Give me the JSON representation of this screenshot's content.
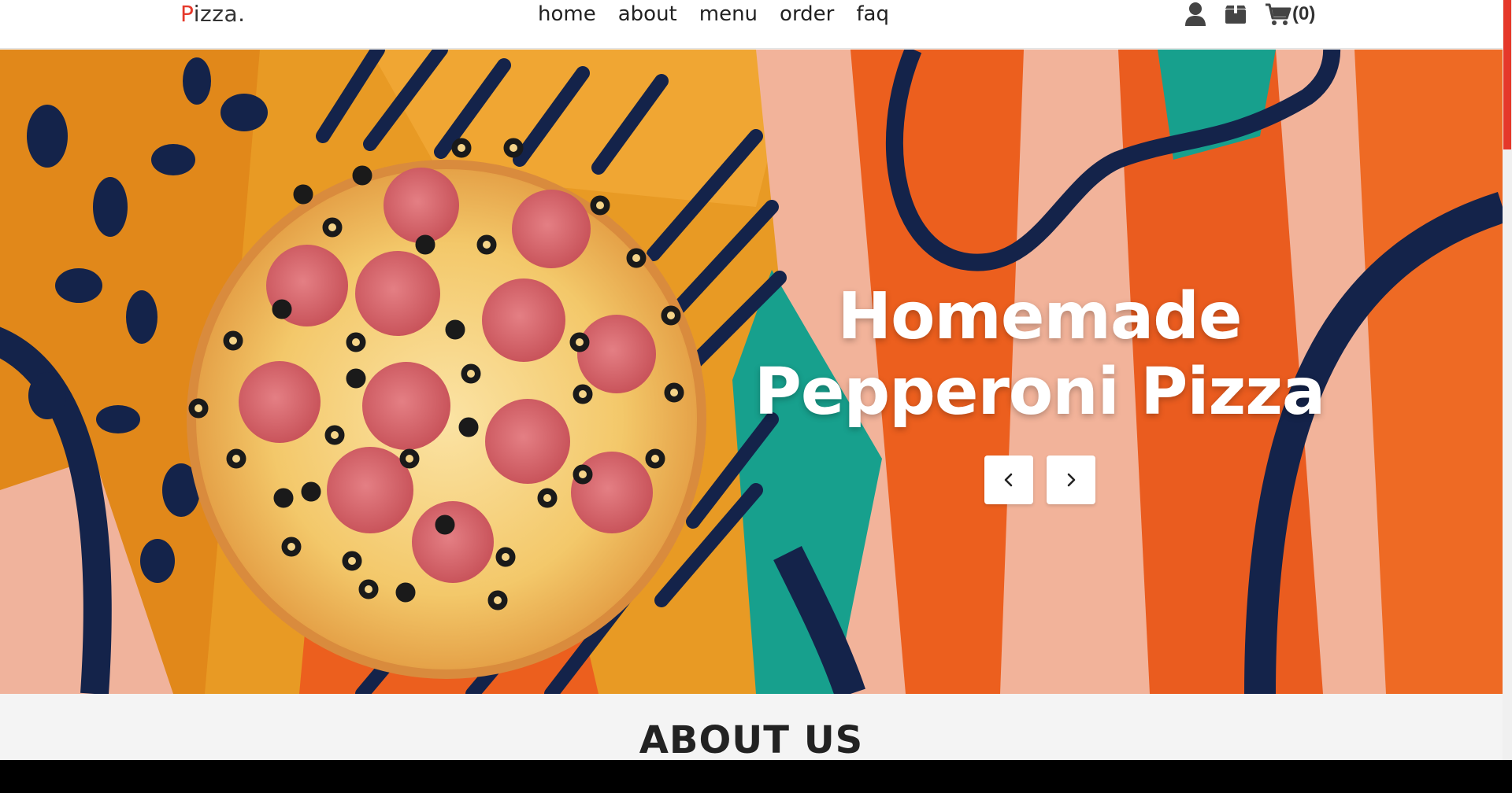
{
  "brand": {
    "logo_first": "P",
    "logo_rest": "izza.",
    "accent": "#e5382a"
  },
  "nav": {
    "items": [
      {
        "label": "home"
      },
      {
        "label": "about"
      },
      {
        "label": "menu"
      },
      {
        "label": "order"
      },
      {
        "label": "faq"
      }
    ]
  },
  "header_icons": {
    "user": "user-icon",
    "orders": "box-icon",
    "cart": "cart-icon",
    "cart_count": "(0)"
  },
  "hero": {
    "title_line1": "Homemade",
    "title_line2": "Pepperoni Pizza",
    "prev_icon": "chevron-left-icon",
    "next_icon": "chevron-right-icon"
  },
  "about": {
    "title": "ABOUT US"
  }
}
